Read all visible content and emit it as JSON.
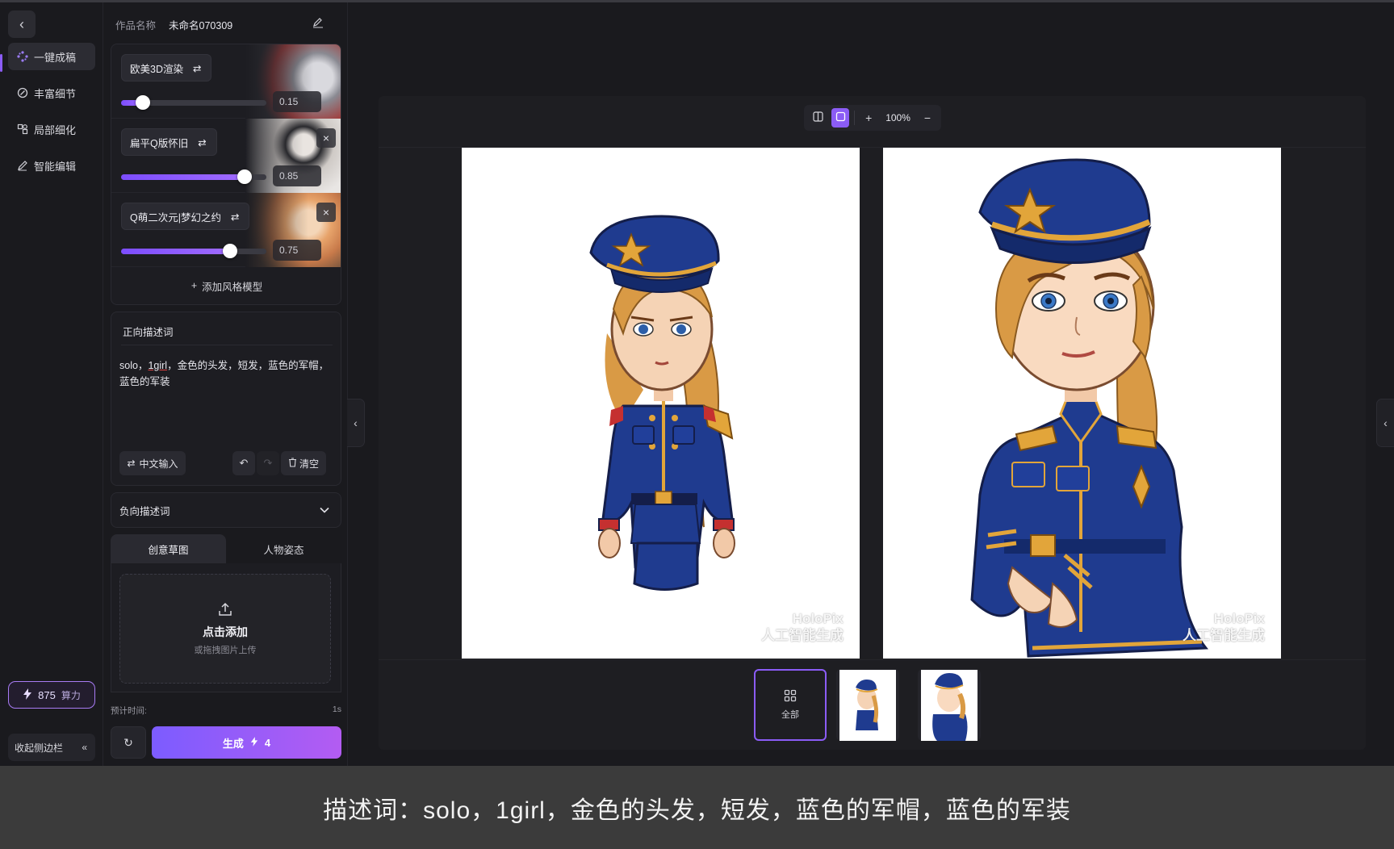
{
  "nav": {
    "items": [
      {
        "label": "一键成稿",
        "icon": "sparkle-icon",
        "active": true
      },
      {
        "label": "丰富细节",
        "icon": "detail-icon",
        "active": false
      },
      {
        "label": "局部细化",
        "icon": "region-icon",
        "active": false
      },
      {
        "label": "智能编辑",
        "icon": "pen-icon",
        "active": false
      }
    ],
    "credits": {
      "value": "875",
      "label": "算力"
    },
    "collapse_label": "收起侧边栏"
  },
  "panel": {
    "work_name_label": "作品名称",
    "work_name_value": "未命名070309",
    "styles": [
      {
        "name": "欧美3D渲染",
        "value": "0.15",
        "level": 0.15
      },
      {
        "name": "扁平Q版怀旧",
        "value": "0.85",
        "level": 0.85
      },
      {
        "name": "Q萌二次元|梦幻之约",
        "value": "0.75",
        "level": 0.75
      }
    ],
    "add_style": "添加风格模型",
    "positive": {
      "title": "正向描述词",
      "text_parts": [
        "solo，",
        "1girl",
        "，金色的头发，短发，蓝色的军帽，蓝色的军装"
      ],
      "cn_input": "中文输入",
      "clear": "清空"
    },
    "negative": {
      "title": "负向描述词"
    },
    "tabs": [
      {
        "label": "创意草图",
        "active": true
      },
      {
        "label": "人物姿态",
        "active": false
      }
    ],
    "upload": {
      "main": "点击添加",
      "sub": "或拖拽图片上传"
    },
    "estimate": {
      "label": "预计时间:",
      "value": "1s"
    },
    "generate": {
      "label": "生成",
      "cost": "4"
    }
  },
  "canvas": {
    "zoom": "100%",
    "watermark_line1": "HoloPix",
    "watermark_line2": "人工智能生成",
    "thumbs_all_label": "全部"
  },
  "caption": "描述词：solo，1girl，金色的头发，短发，蓝色的军帽，蓝色的军装",
  "colors": {
    "accent": "#8b5cf6",
    "uniform": "#1f3b8f",
    "hair": "#d99a45",
    "trim": "#e2a53a"
  }
}
